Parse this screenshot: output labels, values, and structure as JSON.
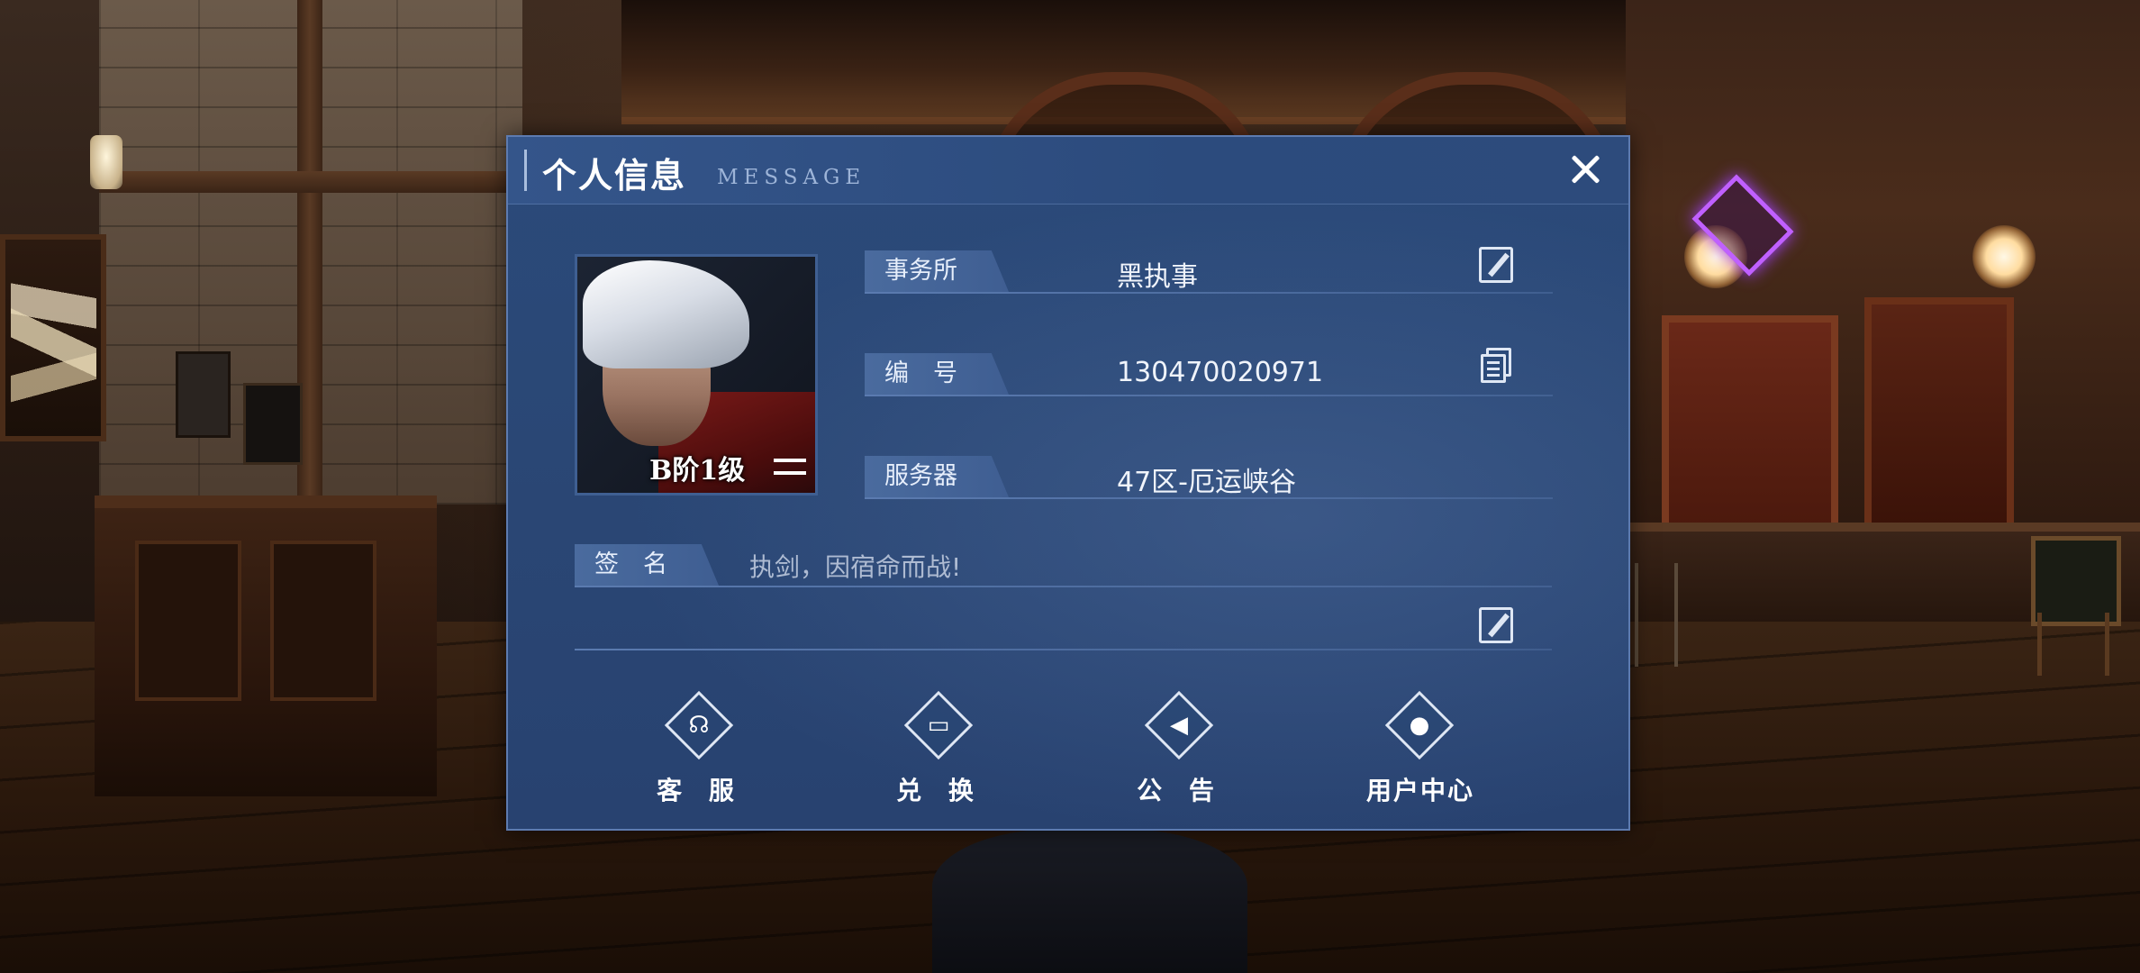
{
  "panel": {
    "title": "个人信息",
    "subtitle": "MESSAGE"
  },
  "profile": {
    "rank": "B阶1级"
  },
  "info": {
    "agency": {
      "label": "事务所",
      "value": "黑执事"
    },
    "id": {
      "label": "编　号",
      "value": "130470020971"
    },
    "server": {
      "label": "服务器",
      "value": "47区-厄运峡谷"
    },
    "signature": {
      "label": "签　名",
      "value": "执剑，因宿命而战!"
    }
  },
  "actions": [
    {
      "label": "客 服",
      "icon": "headset-icon"
    },
    {
      "label": "兑 换",
      "icon": "ticket-icon"
    },
    {
      "label": "公 告",
      "icon": "megaphone-icon"
    },
    {
      "label": "用户中心",
      "icon": "user-icon"
    }
  ],
  "colors": {
    "panel": "#2a4775",
    "label_bg": "#4a6b9e",
    "text": "#ffffff"
  }
}
